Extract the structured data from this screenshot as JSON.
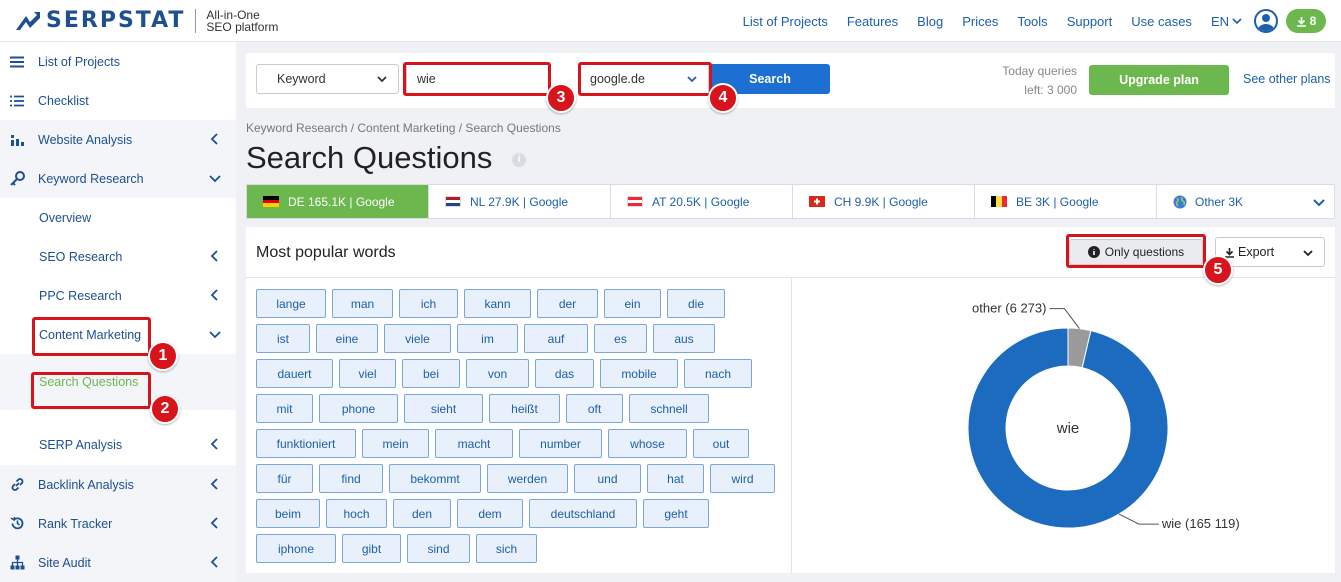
{
  "header": {
    "logo_text": "SERPSTAT",
    "logo_sub_line1": "All-in-One",
    "logo_sub_line2": "SEO platform",
    "nav": [
      "List of Projects",
      "Features",
      "Blog",
      "Prices",
      "Tools",
      "Support",
      "Use cases"
    ],
    "language": "EN",
    "downloads_count": "8"
  },
  "sidebar": {
    "items": [
      {
        "label": "List of Projects",
        "icon": "menu-icon"
      },
      {
        "label": "Checklist",
        "icon": "checklist-icon"
      },
      {
        "label": "Website Analysis",
        "icon": "chart-icon"
      },
      {
        "label": "Keyword Research",
        "icon": "key-icon"
      },
      {
        "label": "Overview"
      },
      {
        "label": "SEO Research"
      },
      {
        "label": "PPC Research"
      },
      {
        "label": "Content Marketing"
      },
      {
        "label": "Search Questions"
      },
      {
        "label": "SERP Analysis"
      },
      {
        "label": "Backlink Analysis",
        "icon": "link-icon"
      },
      {
        "label": "Rank Tracker",
        "icon": "history-icon"
      },
      {
        "label": "Site Audit",
        "icon": "sitemap-icon"
      }
    ]
  },
  "search": {
    "type_select": "Keyword",
    "query": "wie",
    "database": "google.de",
    "button": "Search",
    "queries_line1": "Today queries",
    "queries_line2": "left: 3 000",
    "upgrade_button": "Upgrade plan",
    "plans_link": "See other plans"
  },
  "breadcrumb": "Keyword Research / Content Marketing / Search Questions",
  "page_title": "Search Questions",
  "tabs": [
    {
      "label": "DE 165.1K | Google",
      "flag": "de",
      "active": true
    },
    {
      "label": "NL 27.9K | Google",
      "flag": "nl"
    },
    {
      "label": "AT 20.5K | Google",
      "flag": "at"
    },
    {
      "label": "CH 9.9K | Google",
      "flag": "ch"
    },
    {
      "label": "BE 3K | Google",
      "flag": "be"
    },
    {
      "label": "Other 3K",
      "flag": "globe"
    }
  ],
  "card": {
    "title": "Most popular words",
    "only_questions_button": "Only questions",
    "export_button": "Export"
  },
  "words": [
    [
      "lange",
      "man",
      "ich",
      "kann",
      "der",
      "ein",
      "die"
    ],
    [
      "ist",
      "eine",
      "viele",
      "im",
      "auf",
      "es",
      "aus"
    ],
    [
      "dauert",
      "viel",
      "bei",
      "von",
      "das",
      "mobile",
      "nach"
    ],
    [
      "mit",
      "phone",
      "sieht",
      "heißt",
      "oft",
      "schnell"
    ],
    [
      "funktioniert",
      "mein",
      "macht",
      "number",
      "whose",
      "out"
    ],
    [
      "für",
      "find",
      "bekommt",
      "werden",
      "und",
      "hat",
      "wird"
    ],
    [
      "beim",
      "hoch",
      "den",
      "dem",
      "deutschland",
      "geht"
    ],
    [
      "iphone",
      "gibt",
      "sind",
      "sich"
    ]
  ],
  "annotations": [
    "1",
    "2",
    "3",
    "4",
    "5"
  ],
  "colors": {
    "brand_blue": "#1d4f91",
    "link_blue": "#1d5fa8",
    "green": "#6cb84f",
    "annotation_red": "#d7131c",
    "donut_blue": "#1d6bbf",
    "donut_grey": "#9a9a9a"
  },
  "chart_data": {
    "type": "pie",
    "center_label": "wie",
    "slices": [
      {
        "label": "wie (165 119)",
        "value": 165119
      },
      {
        "label": "other (6 273)",
        "value": 6273
      }
    ]
  }
}
